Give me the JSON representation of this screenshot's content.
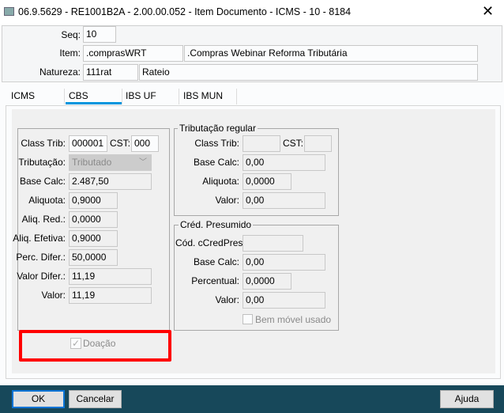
{
  "window": {
    "title": "06.9.5629 - RE1001B2A - 2.00.00.052 - Item Documento - ICMS - 10 - 8184",
    "close_icon": "close-icon"
  },
  "header": {
    "seq_label": "Seq:",
    "seq": "10",
    "item_label": "Item:",
    "item_code": ".comprasWRT",
    "item_desc": ".Compras Webinar Reforma Tributária",
    "natureza_label": "Natureza:",
    "natureza_code": "111rat",
    "natureza_desc": "Rateio"
  },
  "tabs": [
    {
      "label": "ICMS"
    },
    {
      "label": "CBS",
      "active": true
    },
    {
      "label": "IBS UF"
    },
    {
      "label": "IBS MUN"
    }
  ],
  "accent": "#0095dd",
  "cbs": {
    "class_trib_label": "Class Trib:",
    "class_trib": "000001",
    "cst_label": "CST:",
    "cst": "000",
    "tributacao_label": "Tributação:",
    "tributacao": "Tributado",
    "base_calc_label": "Base Calc:",
    "base_calc": "2.487,50",
    "aliquota_label": "Aliquota:",
    "aliquota": "0,9000",
    "aliq_red_label": "Aliq. Red.:",
    "aliq_red": "0,0000",
    "aliq_efetiva_label": "Aliq. Efetiva:",
    "aliq_efetiva": "0,9000",
    "perc_difer_label": "Perc. Difer.:",
    "perc_difer": "50,0000",
    "valor_difer_label": "Valor Difer.:",
    "valor_difer": "11,19",
    "valor_label": "Valor:",
    "valor": "11,19",
    "doacao_label": "Doação",
    "doacao_checked": true,
    "highlight_color": "#ff0000"
  },
  "regular": {
    "title": "Tributação regular",
    "class_trib_label": "Class Trib:",
    "class_trib": "",
    "cst_label": "CST:",
    "cst": "",
    "base_calc_label": "Base Calc:",
    "base_calc": "0,00",
    "aliquota_label": "Aliquota:",
    "aliquota": "0,0000",
    "valor_label": "Valor:",
    "valor": "0,00"
  },
  "presumido": {
    "title": "Créd. Presumido",
    "cod_label": "Cód. cCredPres:",
    "cod": "",
    "base_calc_label": "Base Calc:",
    "base_calc": "0,00",
    "percentual_label": "Percentual:",
    "percentual": "0,0000",
    "valor_label": "Valor:",
    "valor": "0,00",
    "bem_movel_label": "Bem móvel usado",
    "bem_movel_checked": false
  },
  "footer": {
    "ok": "OK",
    "cancel": "Cancelar",
    "help": "Ajuda",
    "bg": "#17485a"
  }
}
